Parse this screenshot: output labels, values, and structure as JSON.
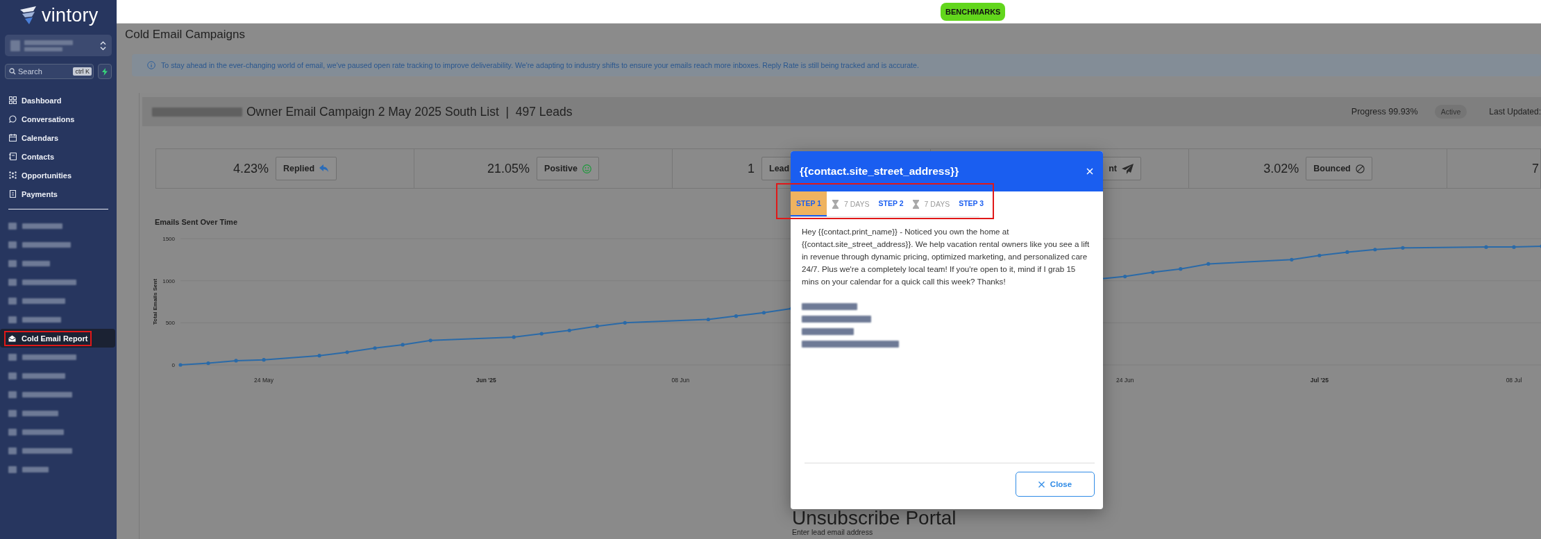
{
  "sidebar": {
    "logo": "vintory",
    "account": {
      "redacted": true
    },
    "search": {
      "placeholder": "Search",
      "shortcut": "ctrl K"
    },
    "nav": [
      {
        "kind": "dashboard",
        "label": "Dashboard",
        "selected": false
      },
      {
        "kind": "conversations",
        "label": "Conversations",
        "selected": false
      },
      {
        "kind": "calendars",
        "label": "Calendars",
        "selected": false
      },
      {
        "kind": "contacts",
        "label": "Contacts",
        "selected": false
      },
      {
        "kind": "opportunities",
        "label": "Opportunities",
        "selected": false
      },
      {
        "kind": "payments",
        "label": "Payments",
        "selected": false
      }
    ],
    "apps": [
      {
        "kind": "redacted",
        "selected": false
      },
      {
        "kind": "redacted",
        "selected": false
      },
      {
        "kind": "redacted",
        "selected": false
      },
      {
        "kind": "redacted",
        "selected": false
      },
      {
        "kind": "redacted",
        "selected": false
      },
      {
        "kind": "redacted",
        "selected": false
      },
      {
        "kind": "report",
        "label": "Cold Email Report",
        "selected": true,
        "highlighted": true
      },
      {
        "kind": "redacted",
        "selected": false
      },
      {
        "kind": "redacted",
        "selected": false
      },
      {
        "kind": "redacted",
        "selected": false
      },
      {
        "kind": "redacted",
        "selected": false
      },
      {
        "kind": "redacted",
        "selected": false
      },
      {
        "kind": "redacted",
        "selected": false
      },
      {
        "kind": "redacted",
        "selected": false
      }
    ]
  },
  "top_bar": {
    "button": "BENCHMARKS"
  },
  "page": {
    "title": "Cold Email Campaigns",
    "notice": "To stay ahead in the ever-changing world of email, we've paused open rate tracking to improve deliverability. We're adapting to industry shifts to ensure your emails reach more inboxes. Reply Rate is still being tracked and is accurate."
  },
  "campaign": {
    "name_redacted": true,
    "title": "Owner Email Campaign 2 May 2025 South List  |  497 Leads",
    "progress": "Progress 99.93%",
    "status": "Active",
    "last_updated": "Last Updated:",
    "stats": [
      {
        "kind": "replied",
        "value": "4.23%",
        "label": "Replied"
      },
      {
        "kind": "positive",
        "value": "21.05%",
        "label": "Positive"
      },
      {
        "kind": "leads",
        "value": "1",
        "label": "Lead"
      },
      {
        "kind": "sent",
        "label": "nt"
      },
      {
        "kind": "bounced",
        "value": "3.02%",
        "label": "Bounced"
      },
      {
        "kind": "other",
        "value": "7"
      }
    ],
    "chart_data": {
      "type": "line",
      "title": "Emails Sent Over Time",
      "ylabel": "Total Emails Sent",
      "x": [
        "2025-05-21",
        "2025-05-22",
        "2025-05-23",
        "2025-05-24",
        "2025-05-26",
        "2025-05-27",
        "2025-05-28",
        "2025-05-29",
        "2025-05-30",
        "2025-06-02",
        "2025-06-03",
        "2025-06-04",
        "2025-06-05",
        "2025-06-06",
        "2025-06-09",
        "2025-06-10",
        "2025-06-11",
        "2025-06-12",
        "2025-06-24",
        "2025-06-25",
        "2025-06-26",
        "2025-06-27",
        "2025-06-30",
        "2025-07-01",
        "2025-07-02",
        "2025-07-03",
        "2025-07-04",
        "2025-07-07",
        "2025-07-08",
        "2025-07-09"
      ],
      "series": [
        {
          "color": "#2a6aa8",
          "values": [
            0,
            20,
            50,
            60,
            110,
            150,
            200,
            240,
            290,
            330,
            370,
            410,
            460,
            500,
            540,
            580,
            620,
            670,
            1050,
            1100,
            1140,
            1200,
            1250,
            1300,
            1340,
            1370,
            1390,
            1400,
            1400,
            1410
          ]
        }
      ],
      "xlim": [
        "2025-05-21",
        "2025-07-09"
      ],
      "ylim": [
        0,
        1500
      ],
      "yticks": [
        0,
        500,
        1000,
        1500
      ],
      "xticks": [
        {
          "value": "2025-05-24",
          "label": "24 May"
        },
        {
          "value": "2025-06-01",
          "label": "Jun '25"
        },
        {
          "value": "2025-06-08",
          "label": "08 Jun"
        },
        {
          "value": "2025-06-24",
          "label": "24 Jun"
        },
        {
          "value": "2025-07-01",
          "label": "Jul '25"
        },
        {
          "value": "2025-07-08",
          "label": "08 Jul"
        }
      ]
    }
  },
  "unsubscribe": {
    "title": "Unsubscribe Portal",
    "label": "Enter lead email address"
  },
  "modal": {
    "title": "{{contact.site_street_address}}",
    "steps_highlighted": true,
    "steps": [
      {
        "kind": "step",
        "label": "STEP 1",
        "selected": true
      },
      {
        "kind": "delay",
        "label": "7 DAYS"
      },
      {
        "kind": "step",
        "label": "STEP 2",
        "selected": false
      },
      {
        "kind": "delay",
        "label": "7 DAYS"
      },
      {
        "kind": "step",
        "label": "STEP 3",
        "selected": false
      }
    ],
    "body": "Hey {{contact.print_name}} - Noticed you own the home at {{contact.site_street_address}}. We help vacation rental owners like you see a lift in revenue through dynamic pricing, optimized marketing, and personalized care 24/7. Plus we're a completely local team! If you're open to it, mind if I grab 15 mins on your calendar for a quick call this week? Thanks!",
    "signature": [
      {
        "kind": "redacted"
      },
      {
        "kind": "redacted"
      },
      {
        "kind": "redacted"
      },
      {
        "kind": "redacted"
      }
    ],
    "close": "Close"
  }
}
